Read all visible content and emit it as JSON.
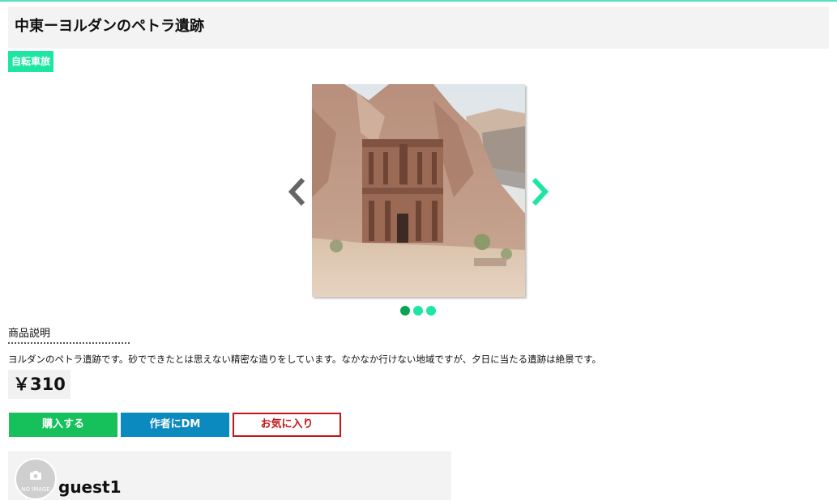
{
  "product": {
    "title": "中東ーヨルダンのペトラ遺跡",
    "tag": "自転車旅",
    "description_label": "商品説明",
    "description": "ヨルダンのペトラ遺跡です。砂でできたとは思えない精密な造りをしています。なかなか行けない地域ですが、夕日に当たる遺跡は絶景です。",
    "price": "￥310"
  },
  "carousel": {
    "slides_total": 3,
    "active_index": 0,
    "prev_icon": "chevron-left-icon",
    "next_icon": "chevron-right-icon"
  },
  "actions": {
    "buy_label": "購入する",
    "dm_label": "作者にDM",
    "favorite_label": "お気に入り"
  },
  "author": {
    "name": "guest1",
    "avatar_placeholder": "NO IMAGE",
    "avatar_icon": "camera-icon"
  },
  "colors": {
    "accent": "#1de6a3",
    "buy": "#16c05a",
    "dm": "#0b8ac0",
    "favorite": "#c41616",
    "dot_active": "#07a553"
  }
}
